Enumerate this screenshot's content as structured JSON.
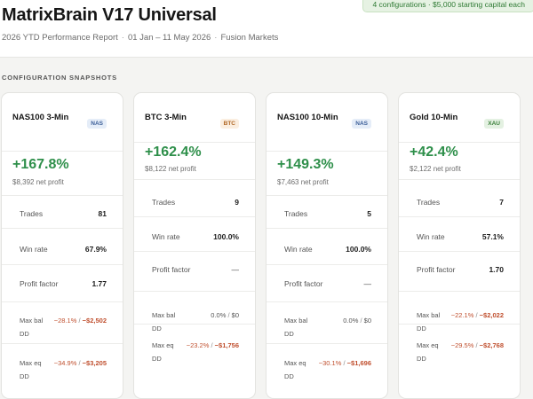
{
  "header": {
    "title": "MatrixBrain V17 Universal",
    "subtitle_parts": [
      "2026 YTD Performance Report",
      "01 Jan – 11 May 2026",
      "Fusion Markets"
    ],
    "separator": "·",
    "pill": "4 configurations · $5,000 starting capital each"
  },
  "section_title": "CONFIGURATION SNAPSHOTS",
  "labels": {
    "trades": "Trades",
    "win_rate": "Win rate",
    "profit_factor": "Profit factor",
    "max_bal_dd": "Max bal DD",
    "max_eq_dd": "Max eq DD",
    "dd_sep": "/"
  },
  "cards": [
    {
      "name": "NAS100 3-Min",
      "badge": "NAS",
      "badge_type": "nas",
      "return_pct": "+167.8%",
      "net_profit": "$8,392 net profit",
      "trades": "81",
      "win_rate": "67.9%",
      "profit_factor": "1.77",
      "max_bal_dd_pct": "−28.1%",
      "max_bal_dd_amt": "−$2,502",
      "max_eq_dd_pct": "−34.9%",
      "max_eq_dd_amt": "−$3,205",
      "negative": true,
      "layout": "tall"
    },
    {
      "name": "BTC 3-Min",
      "badge": "BTC",
      "badge_type": "btc",
      "return_pct": "+162.4%",
      "net_profit": "$8,122 net profit",
      "trades": "9",
      "win_rate": "100.0%",
      "profit_factor": "—",
      "max_bal_dd_pct": "0.0%",
      "max_bal_dd_amt": "$0",
      "max_eq_dd_pct": "−23.2%",
      "max_eq_dd_amt": "−$1,756",
      "negative": false,
      "layout": "short"
    },
    {
      "name": "NAS100 10-Min",
      "badge": "NAS",
      "badge_type": "nas",
      "return_pct": "+149.3%",
      "net_profit": "$7,463 net profit",
      "trades": "5",
      "win_rate": "100.0%",
      "profit_factor": "—",
      "max_bal_dd_pct": "0.0%",
      "max_bal_dd_amt": "$0",
      "max_eq_dd_pct": "−30.1%",
      "max_eq_dd_amt": "−$1,696",
      "negative": false,
      "layout": "tall"
    },
    {
      "name": "Gold 10-Min",
      "badge": "XAU",
      "badge_type": "xau",
      "return_pct": "+42.4%",
      "net_profit": "$2,122 net profit",
      "trades": "7",
      "win_rate": "57.1%",
      "profit_factor": "1.70",
      "max_bal_dd_pct": "−22.1%",
      "max_bal_dd_amt": "−$2,022",
      "max_eq_dd_pct": "−29.5%",
      "max_eq_dd_amt": "−$2,768",
      "negative": true,
      "layout": "short"
    }
  ]
}
